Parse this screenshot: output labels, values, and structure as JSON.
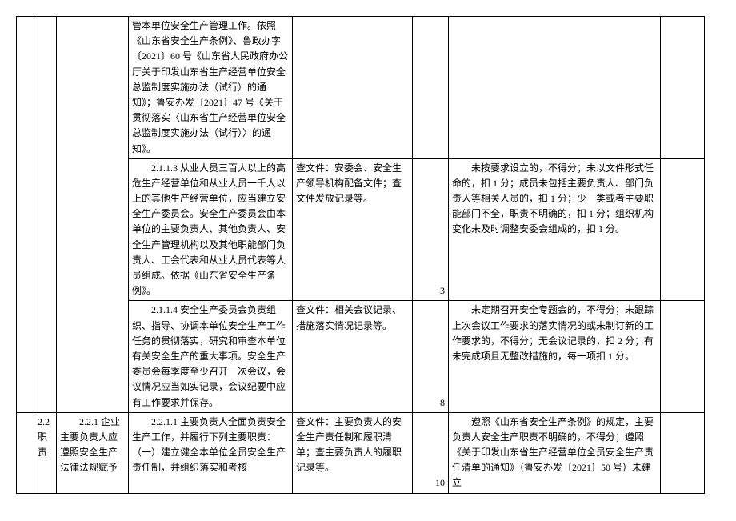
{
  "rows": [
    {
      "col1": "",
      "col2": "",
      "col3": "",
      "requirement": "管本单位安全生产管理工作。依照《山东省安全生产条例》、鲁政办字〔2021〕60 号《山东省人民政府办公厅关于印发山东省生产经营单位安全总监制度实施办法（试行）的通知》；鲁安办发〔2021〕47 号《关于贯彻落实〈山东省生产经营单位安全总监制度实施办法（试行）〉的通知》。",
      "method": "",
      "score": "",
      "criteria": "",
      "remark": ""
    },
    {
      "col1": "",
      "col2": "",
      "col3": "",
      "requirement": "　　2.1.1.3 从业人员三百人以上的高危生产经营单位和从业人员一千人以上的其他生产经营单位，应当建立安全生产委员会。安全生产委员会由本单位的主要负责人、其他负责人、安全生产管理机构以及其他职能部门负责人、工会代表和从业人员代表等人员组成。依据《山东省安全生产条例》。",
      "method": "查文件：安委会、安全生产领导机构配备文件；查文件发放记录等。",
      "score": "3",
      "criteria": "　　未按要求设立的，不得分；未以文件形式任命的，扣 1 分；成员未包括主要负责人、部门负责人等相关人员的，扣 1 分；少一类或者主要职能部门不全，职责不明确的，扣 1 分；组织机构变化未及时调整安委会组成的，扣 1 分。",
      "remark": ""
    },
    {
      "col1": "",
      "col2": "",
      "col3": "",
      "requirement": "　　2.1.1.4 安全生产委员会负责组织、指导、协调本单位安全生产工作任务的贯彻落实，研究和审查本单位有关安全生产的重大事项。安全生产委员会每季度至少召开一次会议，会议情况应当如实记录，会议纪要中应有工作要求并保存。",
      "method": "查文件：相关会议记录、措施落实情况记录等。",
      "score": "8",
      "criteria": "　　未定期召开安全专题会的，不得分；未跟踪上次会议工作要求的落实情况的或未制订新的工作要求的，不得分；无会议记录的，扣 2 分；有未完成项且无整改措施的，每一项扣 1 分。",
      "remark": ""
    },
    {
      "col1": "",
      "col2": "2.2 职责",
      "col3": "　　2.2.1 企业主要负责人应遵照安全生产法律法规赋予",
      "requirement": "　　2.2.1.1 主要负责人全面负责安全生产工作，并履行下列主要职责：\n（一）建立健全本单位全员安全生产责任制，并组织落实和考核",
      "method": "查文件：主要负责人的安全生产责任制和履职清单；查主要负责人的履职记录等。",
      "score": "10",
      "criteria": "　　遵照《山东省安全生产条例》的规定，主要负责人安全生产职责不明确的，不得分；遵照《关于印发山东省生产经营单位全员安全生产责任清单的通知》（鲁安办发〔2021〕50 号）未建立",
      "remark": ""
    }
  ]
}
